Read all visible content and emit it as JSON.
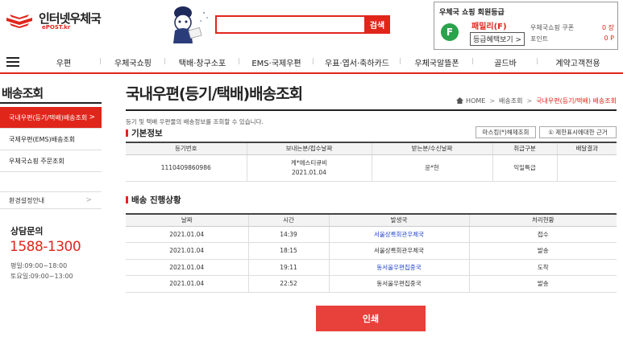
{
  "header": {
    "logo_text": "인터넷우체국",
    "logo_sub": "ePOST.kr",
    "search": {
      "placeholder": "",
      "button": "검색"
    },
    "member": {
      "title": "우체국 쇼핑 회원등급",
      "badge": "F",
      "grade": "패밀리(F)",
      "benefit_button": "등급혜택보기 >",
      "coupon_label": "우체국쇼핑 쿠폰",
      "coupon_value": "0 장",
      "point_label": "포인트",
      "point_value": "0 P"
    }
  },
  "nav": {
    "items": [
      "우편",
      "우체국쇼핑",
      "택배·창구소포",
      "EMS·국제우편",
      "우표·엽서·축하카드",
      "우체국알뜰폰",
      "골드바",
      "계약고객전용"
    ]
  },
  "sidebar": {
    "title": "배송조회",
    "items": [
      {
        "label": "국내우편(등기/택배)배송조회",
        "active": true,
        "arrow": ">"
      },
      {
        "label": "국제우편(EMS)배송조회",
        "active": false,
        "arrow": ""
      },
      {
        "label": "우체국쇼핑 주문조회",
        "active": false,
        "arrow": ""
      }
    ],
    "env": {
      "label": "환경설정안내",
      "arrow": ">"
    },
    "cs": {
      "title": "상담문의",
      "phone": "1588-1300",
      "hours_weekday": "평일:09:00~18:00",
      "hours_saturday": "토요일:09:00~13:00"
    }
  },
  "main": {
    "title": "국내우편(등기/택배)배송조회",
    "breadcrumb": {
      "home": "HOME",
      "b1": "배송조회",
      "b2": "국내우편(등기/택배) 배송조회",
      "sep": ">"
    },
    "description": "등기 및 택배 우편물의 배송정보를 조회할 수 있습니다.",
    "basic": {
      "title": "기본정보",
      "mask_button": "마스킹(*)해제조회",
      "info_button": "① 제한표시에대한 근거",
      "headers": [
        "등기번호",
        "보내는분/접수날짜",
        "받는분/수신날짜",
        "취급구분",
        "배달결과"
      ],
      "row": {
        "number": "1110409860986",
        "sender": "케*에스티큐비",
        "sender_date": "2021.01.04",
        "receiver": "윤*헌",
        "type": "익일특급",
        "result": ""
      }
    },
    "progress": {
      "title": "배송 진행상황",
      "headers": [
        "날짜",
        "시간",
        "발생국",
        "처리현황"
      ],
      "rows": [
        {
          "date": "2021.01.04",
          "time": "14:39",
          "office": "서울상록회관우체국",
          "status": "접수",
          "link": true
        },
        {
          "date": "2021.01.04",
          "time": "18:15",
          "office": "서울상록회관우체국",
          "status": "발송",
          "link": false
        },
        {
          "date": "2021.01.04",
          "time": "19:11",
          "office": "동서울우편집중국",
          "status": "도착",
          "link": true
        },
        {
          "date": "2021.01.04",
          "time": "22:52",
          "office": "동서울우편집중국",
          "status": "발송",
          "link": false
        }
      ]
    },
    "print_button": "인쇄"
  },
  "colors": {
    "accent": "#e0261b",
    "link": "#2244cc",
    "badge": "#2ba24c"
  }
}
